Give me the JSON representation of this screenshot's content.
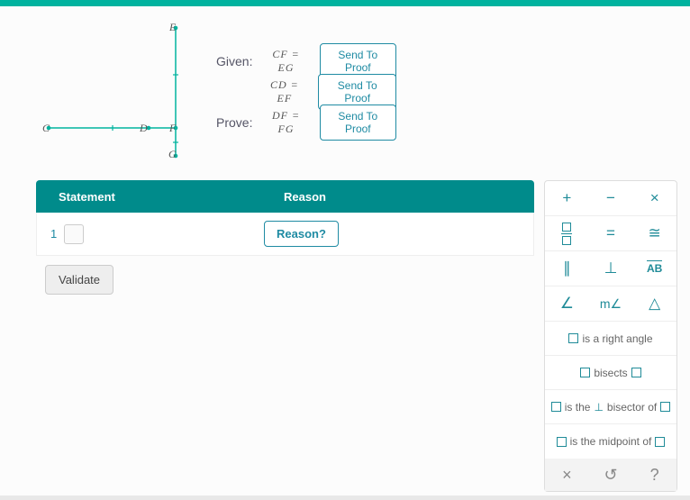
{
  "problem": {
    "points": {
      "E": "E",
      "C": "C",
      "D": "D",
      "F": "F",
      "G": "G"
    },
    "rows": [
      {
        "label": "Given:",
        "expr": "CF = EG",
        "btn": "Send To Proof"
      },
      {
        "label": "",
        "expr": "CD = EF",
        "btn": "Send To Proof"
      },
      {
        "label": "Prove:",
        "expr": "DF = FG",
        "btn": "Send To Proof"
      }
    ]
  },
  "proof": {
    "headers": {
      "statement": "Statement",
      "reason": "Reason"
    },
    "row1": {
      "num": "1",
      "reason_btn": "Reason?"
    },
    "validate": "Validate"
  },
  "palette": {
    "textrows": {
      "right_angle": "is a right angle",
      "bisects": "bisects",
      "perp_bisector_a": "is the",
      "perp_bisector_b": "bisector of",
      "midpoint": "is the midpoint of"
    },
    "footer": {
      "close": "×",
      "undo": "↺",
      "help": "?"
    },
    "symbols": {
      "plus": "+",
      "minus": "−",
      "times": "×",
      "equals": "=",
      "congr": "≅",
      "parallel": "∥",
      "perp": "⊥",
      "segment": "AB",
      "angle": "∠",
      "mangle": "m∠",
      "triangle": "△"
    }
  }
}
